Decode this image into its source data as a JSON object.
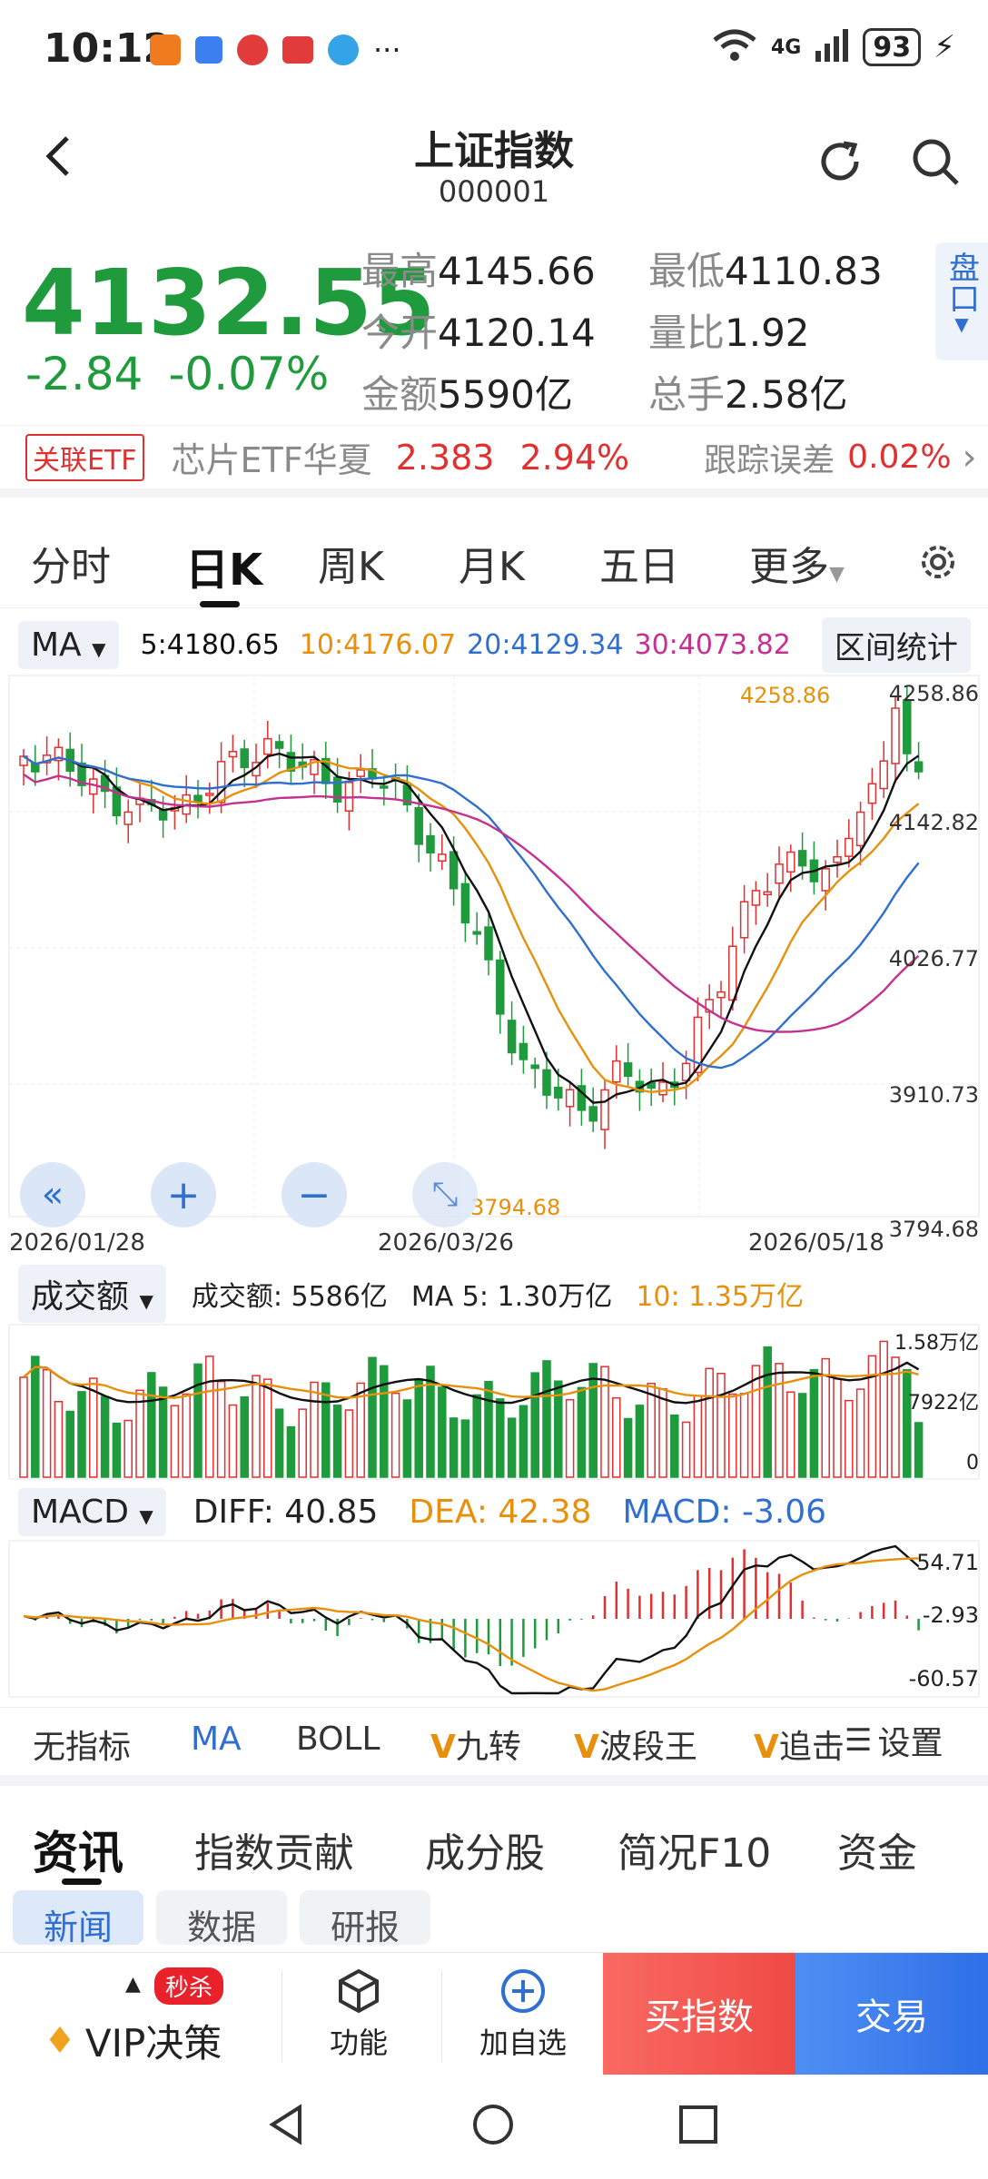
{
  "status": {
    "time": "10:12",
    "more": "···",
    "network": "4G",
    "signal_label": "6",
    "battery": "93"
  },
  "header": {
    "title": "上证指数",
    "code": "000001"
  },
  "quote": {
    "price": "4132.55",
    "change": "-2.84",
    "change_pct": "-0.07%",
    "high_label": "最高",
    "high": "4145.66",
    "low_label": "最低",
    "low": "4110.83",
    "open_label": "今开",
    "open": "4120.14",
    "ratio_label": "量比",
    "ratio": "1.92",
    "amount_label": "金额",
    "amount": "5590亿",
    "volume_label": "总手",
    "volume": "2.58亿",
    "side_label": "盘口"
  },
  "etf": {
    "tag": "关联ETF",
    "name": "芯片ETF华夏",
    "price": "2.383",
    "pct": "2.94%",
    "track_label": "跟踪误差",
    "track": "0.02%"
  },
  "tabs": {
    "items": [
      "分时",
      "日K",
      "周K",
      "月K",
      "五日",
      "更多"
    ],
    "active": 1
  },
  "ma_legend": {
    "selector": "MA",
    "ma5": "5:4180.65",
    "ma10": "10:4176.07",
    "ma20": "20:4129.34",
    "ma30": "30:4073.82",
    "range_stat": "区间统计"
  },
  "kchart": {
    "y_labels": [
      "4258.86",
      "4142.82",
      "4026.77",
      "3910.73",
      "3794.68"
    ],
    "x_labels": [
      "2026/01/28",
      "2026/03/26",
      "2026/05/18"
    ],
    "high_annot": "4258.86",
    "low_annot": "3794.68"
  },
  "vol_legend": {
    "selector": "成交额",
    "amount": "成交额: 5586亿",
    "ma5": "MA 5: 1.30万亿",
    "ma10": "10: 1.35万亿",
    "y_labels": [
      "1.58万亿",
      "7922亿",
      "0"
    ]
  },
  "macd_legend": {
    "selector": "MACD",
    "diff": "DIFF: 40.85",
    "dea": "DEA: 42.38",
    "macd": "MACD: -3.06",
    "y_labels": [
      "54.71",
      "-2.93",
      "-60.57"
    ]
  },
  "indicators": {
    "items": [
      "无指标",
      "MA",
      "BOLL",
      "九转",
      "波段王",
      "追击"
    ],
    "settings": "设置"
  },
  "info_tabs": {
    "items": [
      "资讯",
      "指数贡献",
      "成分股",
      "简况F10",
      "资金"
    ],
    "sub": [
      "新闻",
      "数据",
      "研报"
    ]
  },
  "bottom": {
    "vip": "VIP决策",
    "vip_badge": "秒杀",
    "func": "功能",
    "add": "加自选",
    "buy": "买指数",
    "trade": "交易"
  },
  "colors": {
    "up": "#e03030",
    "down": "#1f9a3c",
    "ma5": "#111111",
    "ma10": "#e8900c",
    "ma20": "#2f6fd0",
    "ma30": "#c5318f"
  }
}
